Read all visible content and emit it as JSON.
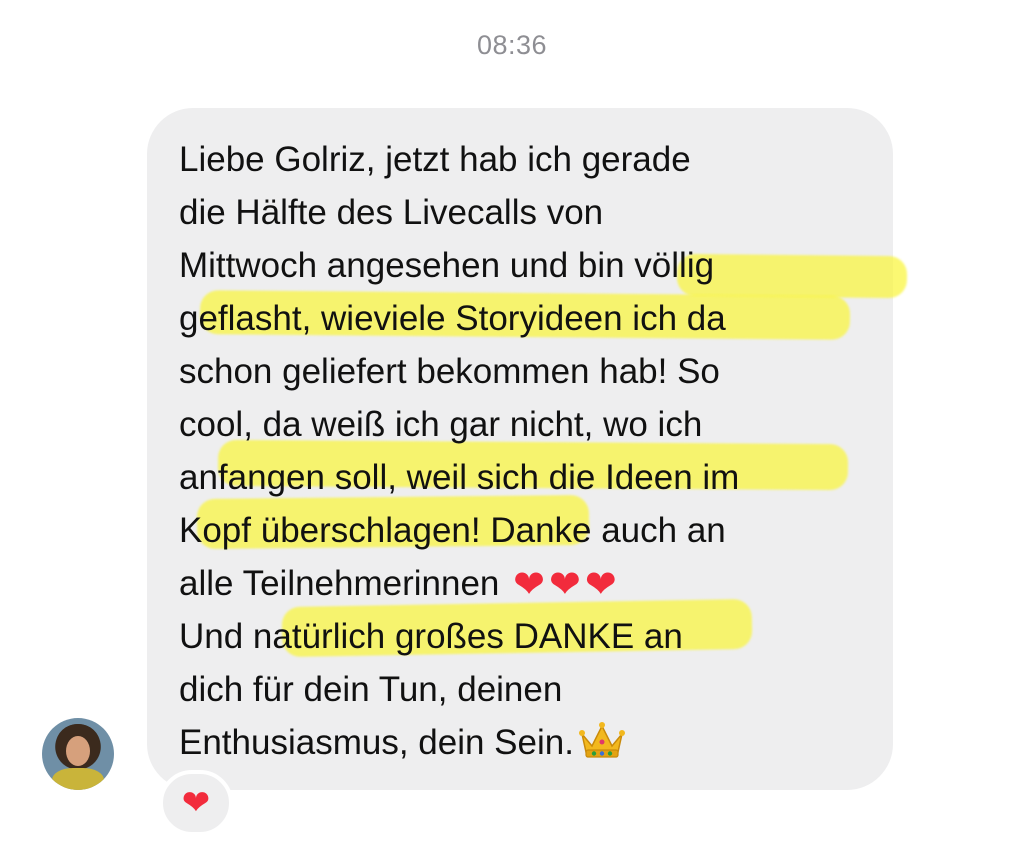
{
  "message": {
    "timestamp": "08:36",
    "lines": [
      "Liebe Golriz, jetzt hab ich gerade",
      "die Hälfte des Livecalls von",
      "Mittwoch angesehen und bin völlig",
      "geflasht, wieviele Storyideen ich da",
      "schon geliefert bekommen hab! So",
      "cool, da weiß ich gar nicht, wo ich",
      "anfangen soll, weil sich die Ideen im",
      "Kopf überschlagen! Danke auch an",
      "alle Teilnehmerinnen",
      "Und natürlich großes DANKE an",
      "dich für dein Tun, deinen",
      "Enthusiasmus, dein Sein."
    ],
    "line9_emoji": [
      "❤",
      "❤",
      "❤"
    ],
    "line12_emoji": "crown-icon",
    "reaction": "❤",
    "highlight_color": "#faf53c",
    "bubble_color": "#eeeeef",
    "heart_color": "#f22b3c"
  },
  "sender": {
    "avatar": "avatar-photo"
  }
}
